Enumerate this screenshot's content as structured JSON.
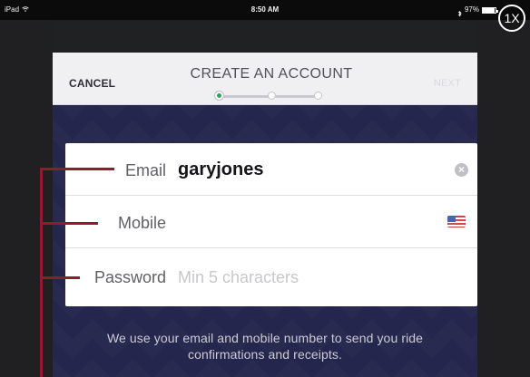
{
  "status_bar": {
    "carrier": "iPad",
    "time": "8:50 AM",
    "battery": "97%",
    "battery_level": 0.97,
    "zoom": "1X"
  },
  "header": {
    "cancel_label": "CANCEL",
    "title": "CREATE AN ACCOUNT",
    "next_label": "NEXT",
    "progress_step": 1,
    "progress_steps": 3
  },
  "form": {
    "email": {
      "label": "Email",
      "value": "garyjones"
    },
    "mobile": {
      "label": "Mobile",
      "value": ""
    },
    "password": {
      "label": "Password",
      "placeholder": "Min 5 characters",
      "value": ""
    }
  },
  "disclaimer": "We use your email and mobile number to send you ride confirmations and receipts.",
  "colors": {
    "accent_green": "#2ba35a",
    "callout": "#8f1b2c",
    "app_background": "#25264d"
  },
  "icons": {
    "clear": "clear-icon",
    "country_flag": "us-flag-icon",
    "wifi": "wifi-icon",
    "bluetooth": "bluetooth-icon",
    "battery": "battery-icon"
  }
}
